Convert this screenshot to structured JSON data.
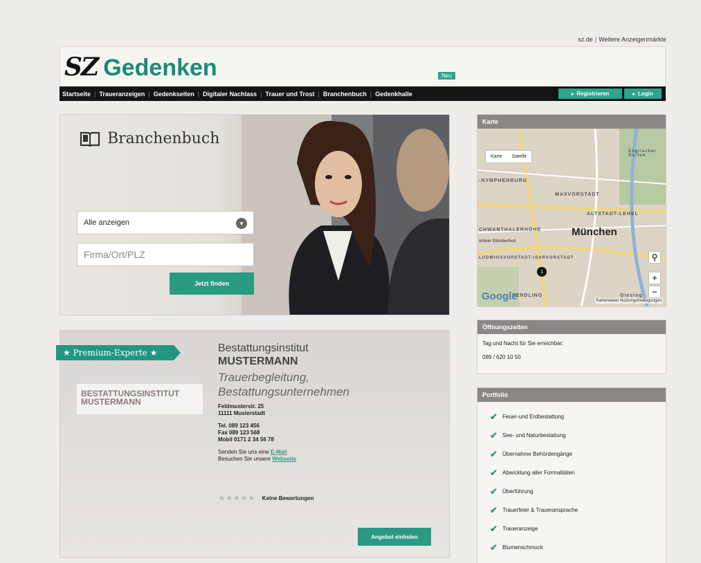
{
  "top_links": {
    "sz": "sz.de",
    "separator": "|",
    "more": "Weitere Anzeigenmärkte"
  },
  "logo": {
    "sz": "SZ",
    "brand": "Gedenken"
  },
  "badge_new": "Neu",
  "nav": {
    "items": [
      "Startseite",
      "Traueranzeigen",
      "Gedenkseiten",
      "Digitaler Nachlass",
      "Trauer und Trost",
      "Branchenbuch",
      "Gedenkhalle"
    ],
    "separator": "|",
    "register": "Registrieren",
    "login": "Login"
  },
  "hero": {
    "title": "Branchenbuch",
    "select_value": "Alle anzeigen",
    "input_placeholder": "Firma/Ort/PLZ",
    "search_button": "Jetzt finden"
  },
  "premium": {
    "ribbon": "★ Premium-Experte ★",
    "logo_text_1": "BESTATTUNGSINSTITUT",
    "logo_text_2": "MUSTERMANN",
    "name_line1": "Bestattungsinstitut",
    "name_line2": "MUSTERMANN",
    "subtitle_line1": "Trauerbegleitung,",
    "subtitle_line2": "Bestattungsunternehmen",
    "street": "Feldmusterstr. 25",
    "city": "11111 Musterstadt",
    "tel": "Tel. 089 123 456",
    "fax": "Fax 089 123 568",
    "mobile": "Mobil 0171 2 34 56 78",
    "email_prefix": "Senden Sie uns eine ",
    "email_link": "E-Mail",
    "web_prefix": "Besuchen Sie unsere ",
    "web_link": "Webseite",
    "stars": "★★★★★",
    "rating_text": "Keine Bewertungen",
    "offer_button": "Angebot einholen"
  },
  "map_widget": {
    "title": "Karte",
    "tab_map": "Karte",
    "tab_satellite": "Satellit",
    "city": "München",
    "labels": [
      "-NYMPHENBURG",
      "MAXVORSTADT",
      "ALTSTADT-LEHEL",
      "CHWANTHALERHÖHE",
      "LUDWIGSVORSTADT-ISARVORSTADT",
      "SENDLING",
      "Giesing",
      "Englischer Garten"
    ],
    "poi": "ichner Oktoberfest",
    "marker": "1",
    "google": "Google",
    "footer": "Kartendaten  Nutzungsbedingungen",
    "zoom_in": "+",
    "zoom_out": "−"
  },
  "hours_widget": {
    "title": "Öffnungszeiten",
    "line1": "Tag und Nacht für Sie erreichbar:",
    "line2": "089 / 620 10 50"
  },
  "portfolio_widget": {
    "title": "Portfolio",
    "items": [
      "Feuer-und Erdbestattung",
      "See- und Naturbestattung",
      "Übernahme Behördengänge",
      "Abwicklung aller Formalitäten",
      "Überführung",
      "Trauerfeier & Traueransprache",
      "Traueranzeige",
      "Blumenschmuck"
    ]
  },
  "colors": {
    "accent": "#2a9a82",
    "nav_bg": "#141414",
    "widget_head": "#8a8785",
    "page_bg": "#efedea"
  }
}
